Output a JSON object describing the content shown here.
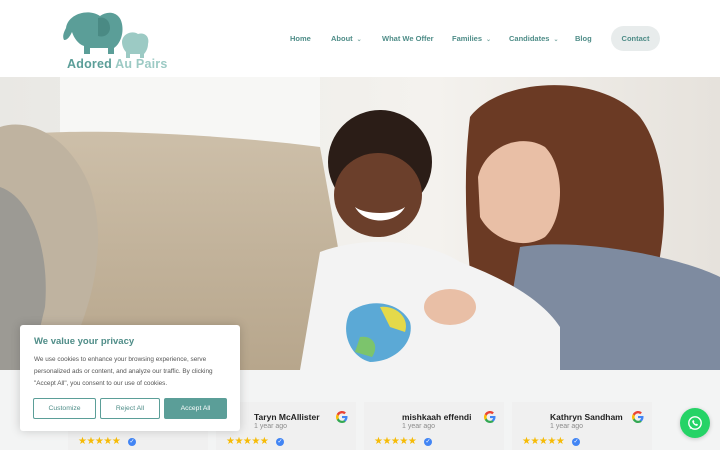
{
  "brand": {
    "name_part1": "Adored",
    "name_part2": "Au Pairs",
    "logo_icon": "elephant-family-icon",
    "primary_color": "#5b9e98",
    "light_color": "#9ccac4"
  },
  "nav": {
    "items": [
      {
        "label": "Home",
        "has_dropdown": false
      },
      {
        "label": "About",
        "has_dropdown": true
      },
      {
        "label": "What We Offer",
        "has_dropdown": false
      },
      {
        "label": "Families",
        "has_dropdown": true
      },
      {
        "label": "Candidates",
        "has_dropdown": true
      },
      {
        "label": "Blog",
        "has_dropdown": false
      }
    ],
    "contact_label": "Contact"
  },
  "hero": {
    "image_description_icon": "hero-photo"
  },
  "reviews": [
    {
      "name": "",
      "time": "",
      "rating": 5
    },
    {
      "name": "Taryn McAllister",
      "time": "1 year ago",
      "rating": 5
    },
    {
      "name": "mishkaah effendi",
      "time": "1 year ago",
      "rating": 5
    },
    {
      "name": "Kathryn Sandham",
      "time": "1 year ago",
      "rating": 5
    }
  ],
  "cookie": {
    "title": "We value your privacy",
    "body": "We use cookies to enhance your browsing experience, serve personalized ads or content, and analyze our traffic. By clicking \"Accept All\", you consent to our use of cookies.",
    "customize_label": "Customize",
    "reject_label": "Reject All",
    "accept_label": "Accept All"
  },
  "whatsapp": {
    "icon": "whatsapp-icon",
    "color": "#25d366"
  }
}
